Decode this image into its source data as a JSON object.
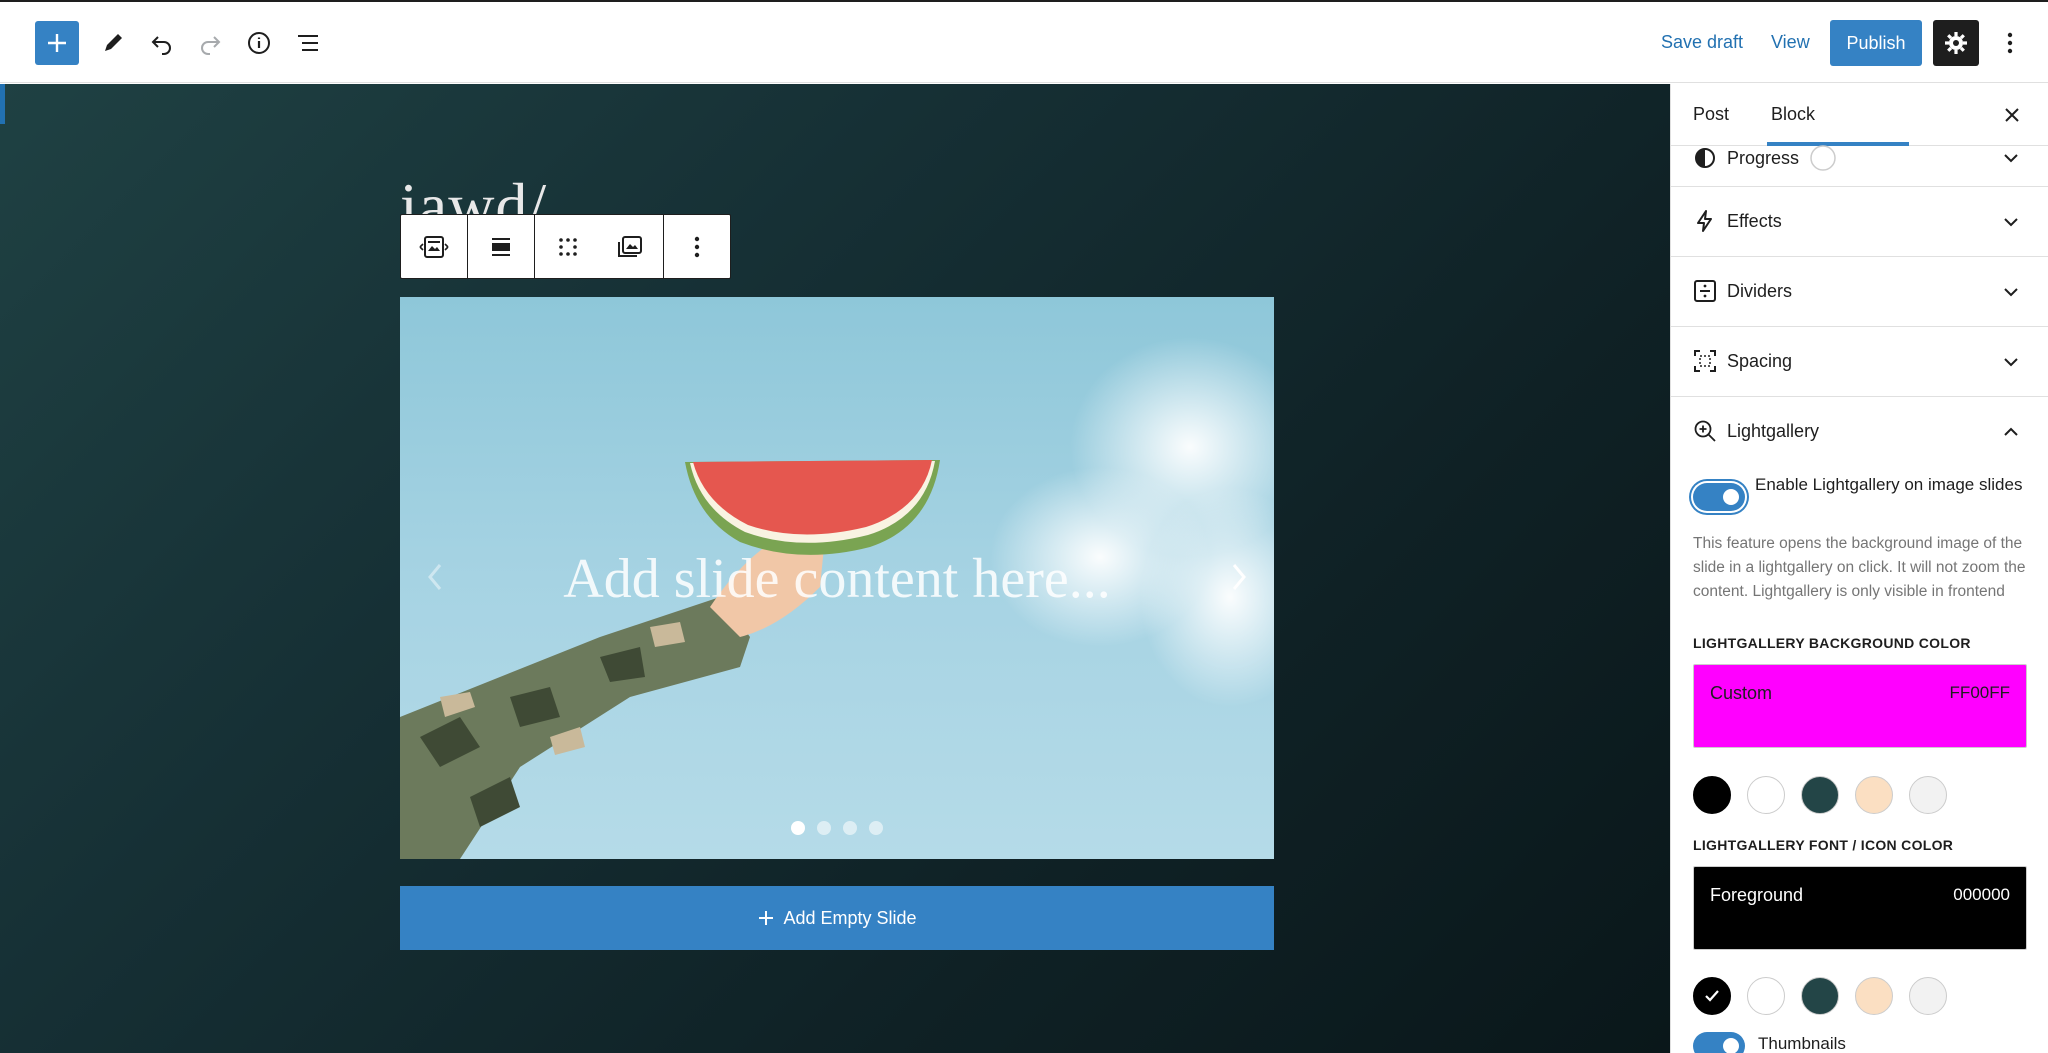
{
  "toolbar": {
    "save_draft": "Save draft",
    "view": "View",
    "publish": "Publish"
  },
  "editor": {
    "post_title": "iawd/",
    "slide_placeholder": "Add slide content here...",
    "add_slide": "Add Empty Slide",
    "slide_count": 4,
    "active_slide": 1
  },
  "sidebar": {
    "tabs": [
      "Post",
      "Block"
    ],
    "active_tab": "Block",
    "panels": {
      "progress": "Progress",
      "effects": "Effects",
      "dividers": "Dividers",
      "spacing": "Spacing",
      "lightgallery": "Lightgallery"
    },
    "enable_label": "Enable Lightgallery on image slides",
    "enable_on": true,
    "help": "This feature opens the background image of the slide in a lightgallery on click. It will not zoom the content. Lightgallery is only visible in frontend",
    "bg_color_label": "LIGHTGALLERY BACKGROUND COLOR",
    "bg_color": {
      "name": "Custom",
      "hex": "FF00FF",
      "value": "#ff00ff"
    },
    "font_color_label": "LIGHTGALLERY FONT / ICON COLOR",
    "font_color": {
      "name": "Foreground",
      "hex": "000000",
      "value": "#000000"
    },
    "palette": [
      "#000000",
      "#ffffff",
      "#234547",
      "#fbdfc2",
      "#f2f2f2"
    ],
    "thumbnails_label": "Thumbnails"
  },
  "colors": {
    "accent": "#3582c4"
  }
}
